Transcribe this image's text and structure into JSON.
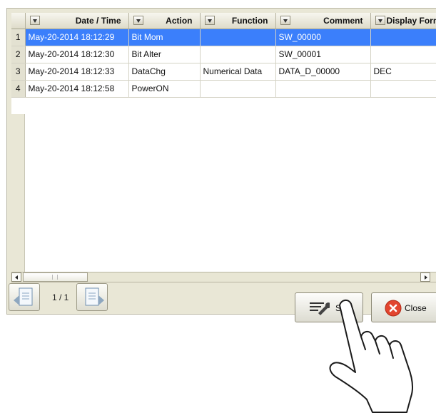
{
  "table": {
    "headers": [
      "Date / Time",
      "Action",
      "Function",
      "Comment",
      "Display Form"
    ],
    "rows": [
      {
        "n": "1",
        "datetime": "May-20-2014 18:12:29",
        "action": "Bit Mom",
        "function": "",
        "comment": "SW_00000",
        "display": ""
      },
      {
        "n": "2",
        "datetime": "May-20-2014 18:12:30",
        "action": "Bit Alter",
        "function": "",
        "comment": "SW_00001",
        "display": ""
      },
      {
        "n": "3",
        "datetime": "May-20-2014 18:12:33",
        "action": "DataChg",
        "function": "Numerical Data",
        "comment": "DATA_D_00000",
        "display": "DEC"
      },
      {
        "n": "4",
        "datetime": "May-20-2014 18:12:58",
        "action": "PowerON",
        "function": "",
        "comment": "",
        "display": ""
      }
    ],
    "selected_row": 1
  },
  "pager": {
    "text": "1 / 1"
  },
  "buttons": {
    "set": "Set",
    "close": "Close"
  },
  "icons": {
    "page_prev": "page-previous-icon",
    "page_next": "page-next-icon",
    "set": "wrench-settings-icon",
    "close": "close-circle-icon",
    "pointer": "hand-pointer-icon"
  },
  "colors": {
    "selection": "#3b7ffb",
    "close_icon": "#e2452f"
  }
}
